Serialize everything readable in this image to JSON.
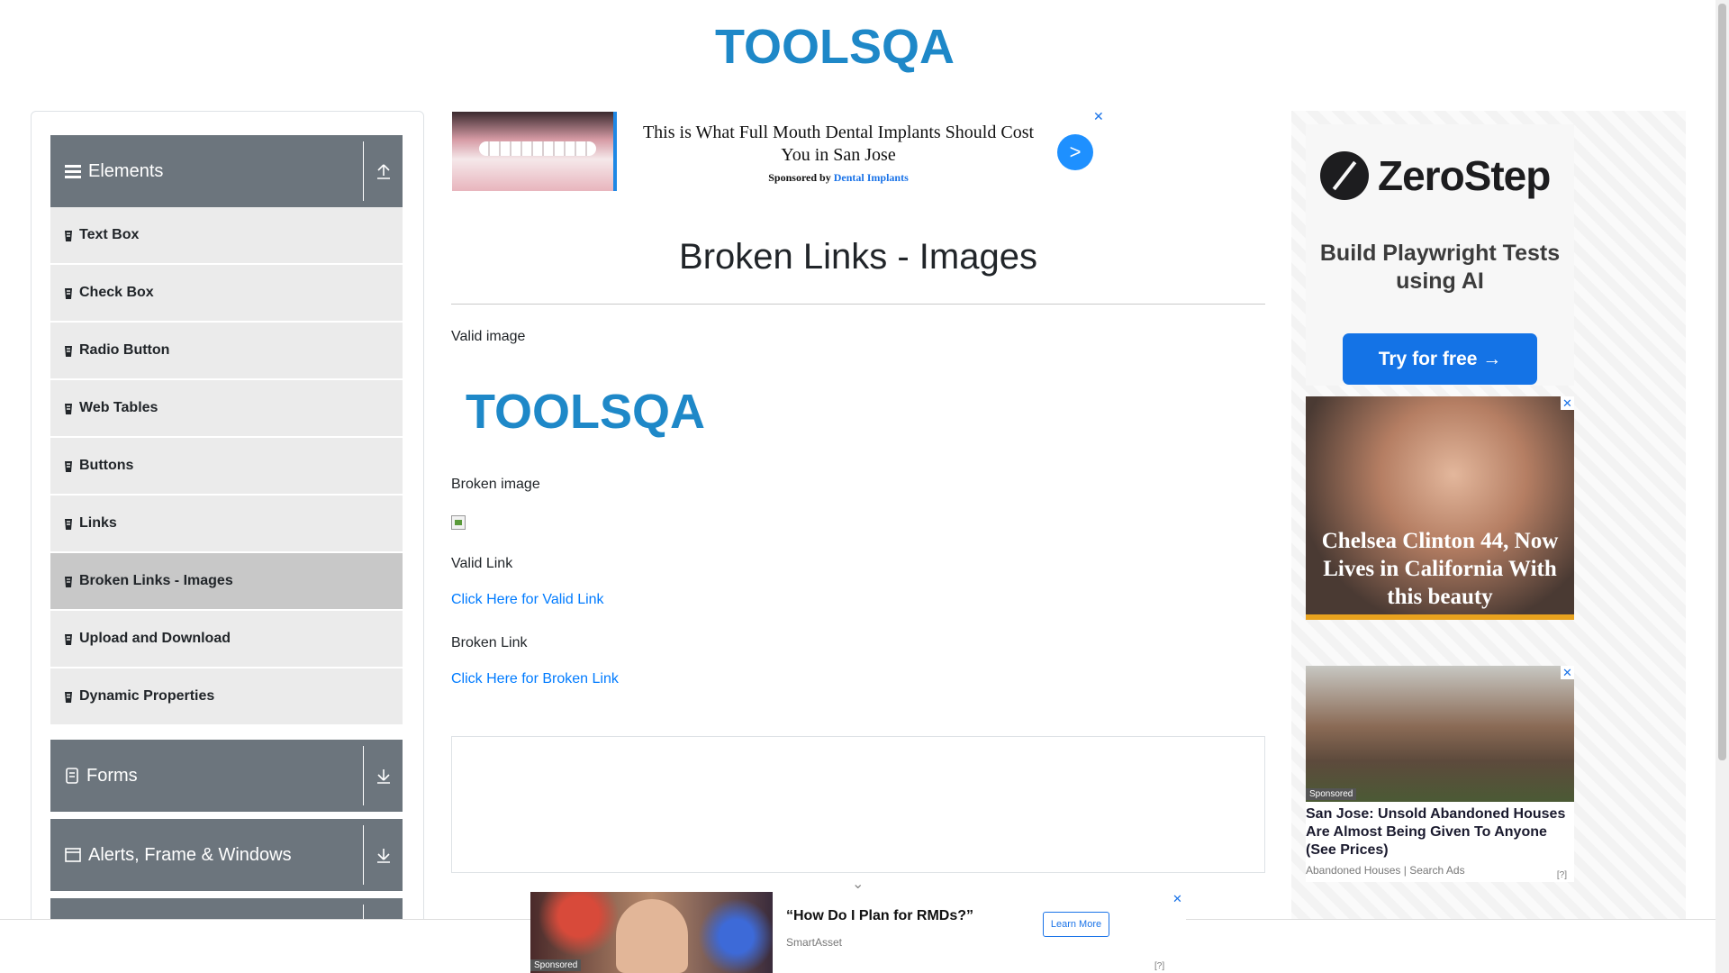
{
  "header": {
    "logo_alt": "TOOLSQA"
  },
  "sidebar": {
    "groups": [
      {
        "label": "Elements",
        "icon": "hamburger-icon",
        "expanded": true
      },
      {
        "label": "Forms",
        "icon": "form-icon",
        "expanded": false
      },
      {
        "label": "Alerts, Frame & Windows",
        "icon": "window-icon",
        "expanded": false
      }
    ],
    "items": [
      {
        "label": "Text Box"
      },
      {
        "label": "Check Box"
      },
      {
        "label": "Radio Button"
      },
      {
        "label": "Web Tables"
      },
      {
        "label": "Buttons"
      },
      {
        "label": "Links"
      },
      {
        "label": "Broken Links - Images",
        "active": true
      },
      {
        "label": "Upload and Download"
      },
      {
        "label": "Dynamic Properties"
      }
    ]
  },
  "ads": {
    "top": {
      "headline": "This is What Full Mouth Dental Implants Should Cost You in San Jose",
      "sponsored_prefix": "Sponsored by ",
      "sponsor": "Dental Implants",
      "arrow": ">",
      "close": "✕"
    },
    "zerostep": {
      "brand": "ZeroStep",
      "tagline": "Build Playwright Tests using AI",
      "cta": "Try for free →"
    },
    "chelsea": {
      "headline": "Chelsea Clinton 44, Now Lives in California With this beauty",
      "close": "✕"
    },
    "house": {
      "badge": "Sponsored",
      "headline": "San Jose: Unsold Abandoned Houses Are Almost Being Given To Anyone (See Prices)",
      "source": "Abandoned Houses | Search Ads",
      "info": "[?]",
      "close": "✕"
    },
    "bottom": {
      "badge": "Sponsored",
      "headline": "“How Do I Plan for RMDs?”",
      "source": "SmartAsset",
      "cta": "Learn More",
      "info": "[?]",
      "close": "✕"
    }
  },
  "main": {
    "title": "Broken Links - Images",
    "valid_image_label": "Valid image",
    "broken_image_label": "Broken image",
    "valid_link_label": "Valid Link",
    "valid_link_text": "Click Here for Valid Link",
    "broken_link_label": "Broken Link",
    "broken_link_text": "Click Here for Broken Link"
  },
  "colors": {
    "accent_blue": "#007bff",
    "sidebar_header": "#6c757d",
    "logo_blue": "#1e88c8",
    "logo_dark": "#3a3a3a"
  }
}
